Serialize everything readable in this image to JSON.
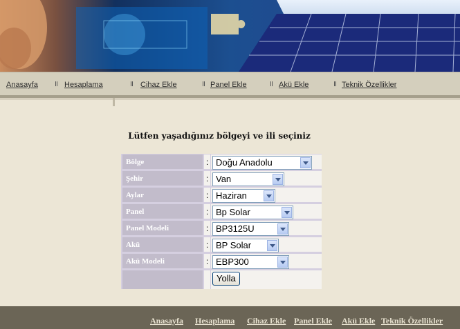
{
  "top_nav": [
    "Anasayfa",
    "Hesaplama",
    "Cihaz Ekle",
    "Panel Ekle",
    "Akü Ekle",
    "Teknik Özellikler"
  ],
  "form": {
    "title": "Lütfen yaşadığınız bölgeyi ve ili seçiniz",
    "colon": ":",
    "rows": [
      {
        "label": "Bölge",
        "value": "Doğu Anadolu"
      },
      {
        "label": "Şehir",
        "value": "Van"
      },
      {
        "label": "Aylar",
        "value": "Haziran"
      },
      {
        "label": "Panel",
        "value": "Bp Solar"
      },
      {
        "label": "Panel Modeli",
        "value": "BP3125U"
      },
      {
        "label": "Akü",
        "value": "BP Solar"
      },
      {
        "label": "Akü Modeli",
        "value": "EBP300"
      }
    ],
    "submit_label": "Yolla"
  },
  "footer_nav": [
    "Anasayfa",
    "Hesaplama",
    "Cihaz Ekle",
    "Panel Ekle",
    "Akü Ekle",
    "Teknik Özellikler"
  ],
  "colors": {
    "nav_bg": "#d4cfbd",
    "footer_bg": "#6b6556",
    "page_bg": "#ece6d6",
    "label_bg": "#c2bccb"
  }
}
